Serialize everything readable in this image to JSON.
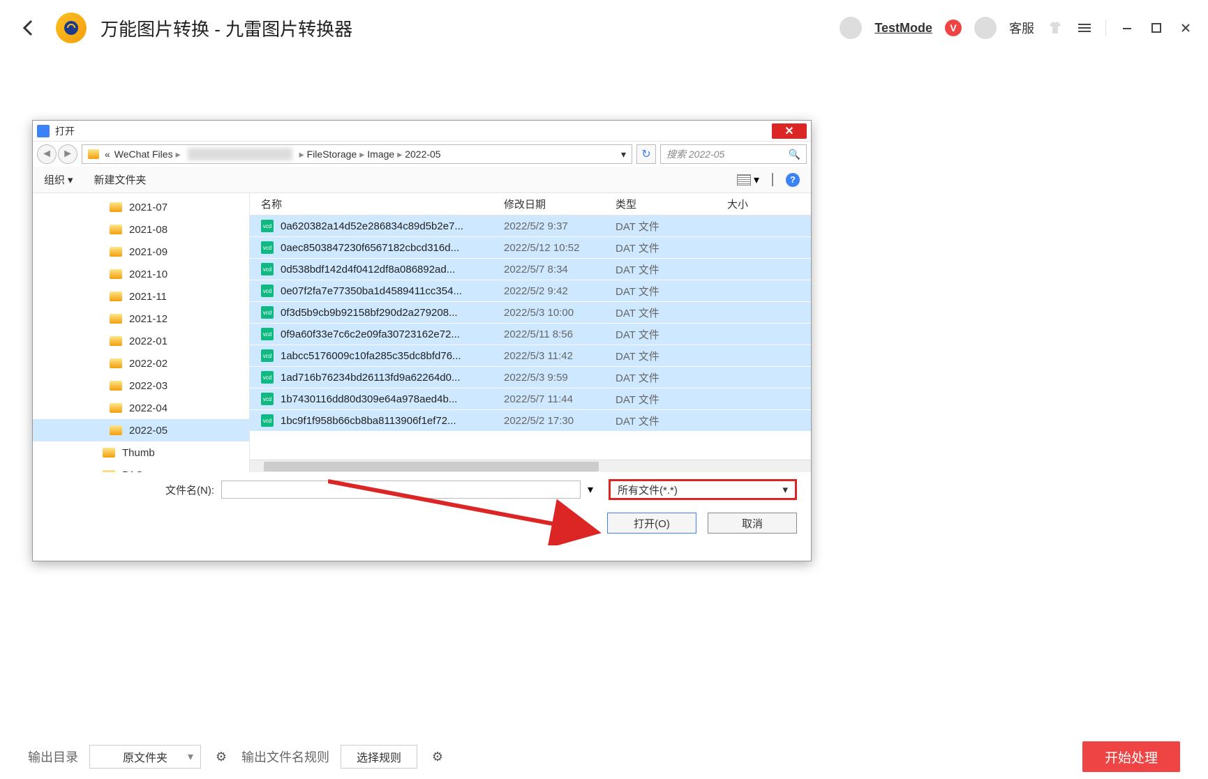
{
  "app": {
    "title": "万能图片转换 - 九雷图片转换器",
    "user": "TestMode",
    "cs": "客服"
  },
  "dialog": {
    "title": "打开",
    "breadcrumb": {
      "prefix": "«",
      "parts": [
        "WeChat Files",
        "FileStorage",
        "Image",
        "2022-05"
      ]
    },
    "search_placeholder": "搜索 2022-05",
    "toolbar": {
      "org": "组织",
      "newfolder": "新建文件夹"
    },
    "columns": {
      "name": "名称",
      "date": "修改日期",
      "type": "类型",
      "size": "大小"
    },
    "tree": [
      {
        "label": "2021-07"
      },
      {
        "label": "2021-08"
      },
      {
        "label": "2021-09"
      },
      {
        "label": "2021-10"
      },
      {
        "label": "2021-11"
      },
      {
        "label": "2021-12"
      },
      {
        "label": "2022-01"
      },
      {
        "label": "2022-02"
      },
      {
        "label": "2022-03"
      },
      {
        "label": "2022-04"
      },
      {
        "label": "2022-05",
        "selected": true
      },
      {
        "label": "Thumb",
        "level": 2
      },
      {
        "label": "PAG",
        "level": 2
      }
    ],
    "files": [
      {
        "name": "0a620382a14d52e286834c89d5b2e7...",
        "date": "2022/5/2 9:37",
        "type": "DAT 文件"
      },
      {
        "name": "0aec8503847230f6567182cbcd316d...",
        "date": "2022/5/12 10:52",
        "type": "DAT 文件"
      },
      {
        "name": "0d538bdf142d4f0412df8a086892ad...",
        "date": "2022/5/7 8:34",
        "type": "DAT 文件"
      },
      {
        "name": "0e07f2fa7e77350ba1d4589411cc354...",
        "date": "2022/5/2 9:42",
        "type": "DAT 文件"
      },
      {
        "name": "0f3d5b9cb9b92158bf290d2a279208...",
        "date": "2022/5/3 10:00",
        "type": "DAT 文件"
      },
      {
        "name": "0f9a60f33e7c6c2e09fa30723162e72...",
        "date": "2022/5/11 8:56",
        "type": "DAT 文件"
      },
      {
        "name": "1abcc5176009c10fa285c35dc8bfd76...",
        "date": "2022/5/3 11:42",
        "type": "DAT 文件"
      },
      {
        "name": "1ad716b76234bd26113fd9a62264d0...",
        "date": "2022/5/3 9:59",
        "type": "DAT 文件"
      },
      {
        "name": "1b7430116dd80d309e64a978aed4b...",
        "date": "2022/5/7 11:44",
        "type": "DAT 文件"
      },
      {
        "name": "1bc9f1f958b66cb8ba8113906f1ef72...",
        "date": "2022/5/2 17:30",
        "type": "DAT 文件"
      }
    ],
    "filename_label": "文件名(N):",
    "filter": "所有文件(*.*)",
    "open_btn": "打开(O)",
    "cancel_btn": "取消"
  },
  "footer": {
    "out_dir": "输出目录",
    "out_dir_val": "原文件夹",
    "name_rule": "输出文件名规则",
    "choose_rule": "选择规则",
    "start": "开始处理"
  }
}
